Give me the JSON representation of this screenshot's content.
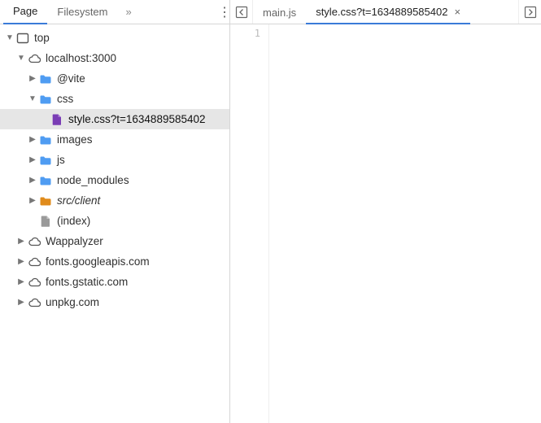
{
  "sidebar": {
    "tabs": [
      {
        "label": "Page",
        "active": true
      },
      {
        "label": "Filesystem",
        "active": false
      }
    ],
    "overflow_glyph": "»"
  },
  "tree": {
    "top": {
      "label": "top",
      "expanded": true
    },
    "localhost": {
      "label": "localhost:3000",
      "expanded": true
    },
    "vite": {
      "label": "@vite",
      "expanded": false
    },
    "css": {
      "label": "css",
      "expanded": true
    },
    "stylefile": {
      "label": "style.css?t=1634889585402",
      "selected": true
    },
    "images": {
      "label": "images",
      "expanded": false
    },
    "js": {
      "label": "js",
      "expanded": false
    },
    "node_modules": {
      "label": "node_modules",
      "expanded": false
    },
    "srcclient": {
      "label": "src/client",
      "expanded": false
    },
    "index": {
      "label": "(index)"
    },
    "wappalyzer": {
      "label": "Wappalyzer",
      "expanded": false
    },
    "googleapis": {
      "label": "fonts.googleapis.com",
      "expanded": false
    },
    "gstatic": {
      "label": "fonts.gstatic.com",
      "expanded": false
    },
    "unpkg": {
      "label": "unpkg.com",
      "expanded": false
    }
  },
  "editor": {
    "tabs": [
      {
        "label": "main.js",
        "active": false,
        "closable": false
      },
      {
        "label": "style.css?t=1634889585402",
        "active": true,
        "closable": true
      }
    ],
    "gutter_line": "1"
  },
  "colors": {
    "folder_blue": "#4f9cf2",
    "folder_orange": "#e08b1b",
    "file_purple": "#7a3db5",
    "file_gray": "#9a9a9a",
    "accent": "#3b7bd8"
  }
}
